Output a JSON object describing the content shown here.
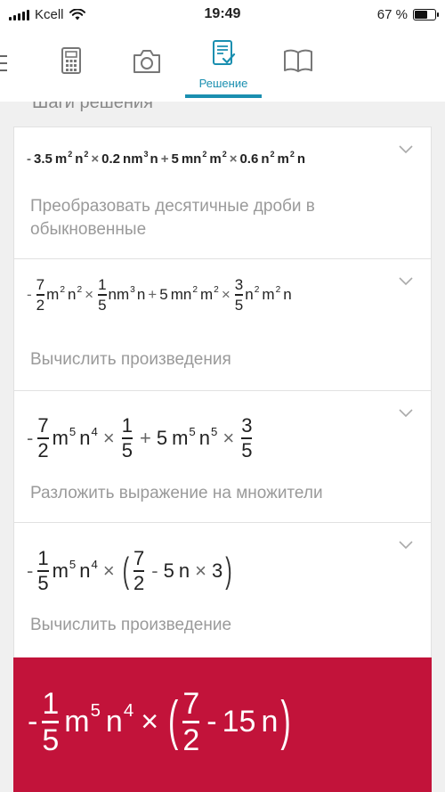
{
  "status_bar": {
    "carrier": "Kcell",
    "time": "19:49",
    "battery_text": "67 %",
    "battery_level": 0.67
  },
  "nav": {
    "tabs": [
      {
        "icon": "calculator-icon",
        "label": ""
      },
      {
        "icon": "camera-icon",
        "label": ""
      },
      {
        "icon": "solution-document-icon",
        "label": "Решение",
        "active": true
      },
      {
        "icon": "book-icon",
        "label": ""
      }
    ],
    "accent": "#1a8fb0"
  },
  "steps_title": "Шаги решения",
  "steps": [
    {
      "expression": "-3.5m²n² × 0.2nm³n + 5mn²m² × 0.6n²m²n",
      "description": "Преобразовать десятичные дроби в обыкновенные"
    },
    {
      "expression": "-7/2 m²n² × 1/5 nm³n + 5mn²m² × 3/5 n²m²n",
      "description": "Вычислить произведения"
    },
    {
      "expression": "-7/2 m⁵n⁴ × 1/5 + 5m⁵n⁵ × 3/5",
      "description": "Разложить выражение на множители"
    },
    {
      "expression": "-1/5 m⁵n⁴ × (7/2 - 5n × 3)",
      "description": "Вычислить произведение"
    }
  ],
  "result": {
    "expression": "-1/5 m⁵n⁴ × (7/2 - 15n)",
    "background": "#c2133a"
  },
  "tokens": {
    "minus": "-",
    "plus": "+",
    "times": "×",
    "lparen": "(",
    "rparen": ")",
    "m": "m",
    "n": "n",
    "nm": "nm",
    "mn": "mn",
    "e2": "2",
    "e3": "3",
    "e4": "4",
    "e5": "5",
    "c35": "3.5",
    "c02": "0.2",
    "c5": "5",
    "c06": "0.6",
    "c15": "15",
    "c3": "3",
    "f7": "7",
    "f2": "2",
    "f1": "1",
    "f5": "5",
    "f3": "3"
  }
}
